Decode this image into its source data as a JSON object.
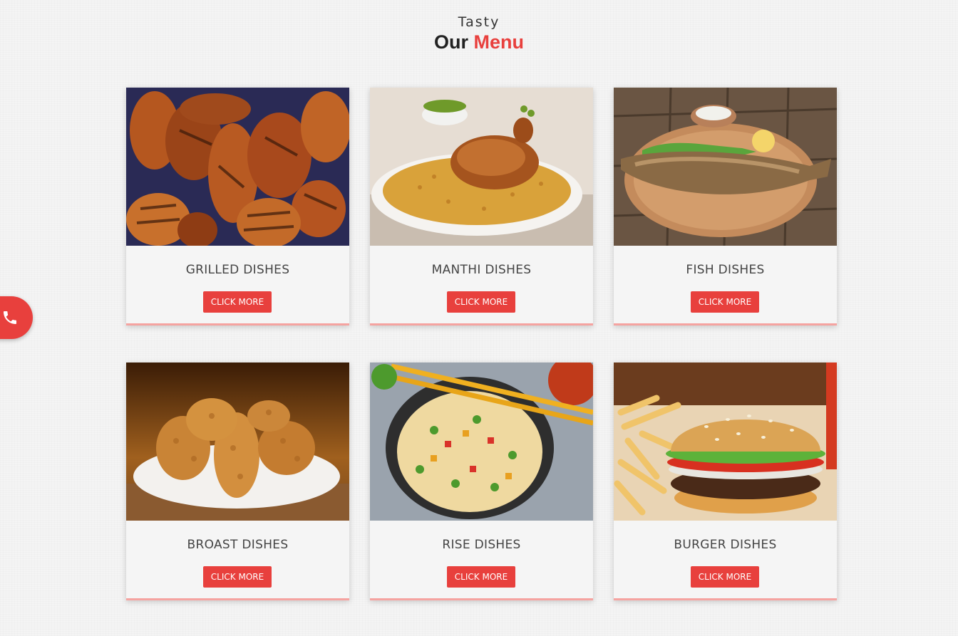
{
  "header": {
    "subtitle": "Tasty",
    "title_main": "Our",
    "title_accent": "Menu"
  },
  "colors": {
    "accent": "#e8403d",
    "card_border": "#f5a3a0",
    "card_bg": "#f5f5f5"
  },
  "menu": [
    {
      "title": "GRILLED DISHES",
      "button": "CLICK MORE"
    },
    {
      "title": "MANTHI DISHES",
      "button": "CLICK MORE"
    },
    {
      "title": "FISH DISHES",
      "button": "CLICK MORE"
    },
    {
      "title": "BROAST DISHES",
      "button": "CLICK MORE"
    },
    {
      "title": "RISE DISHES",
      "button": "CLICK MORE"
    },
    {
      "title": "BURGER DISHES",
      "button": "CLICK MORE"
    }
  ],
  "floating": {
    "icon": "phone-icon"
  }
}
